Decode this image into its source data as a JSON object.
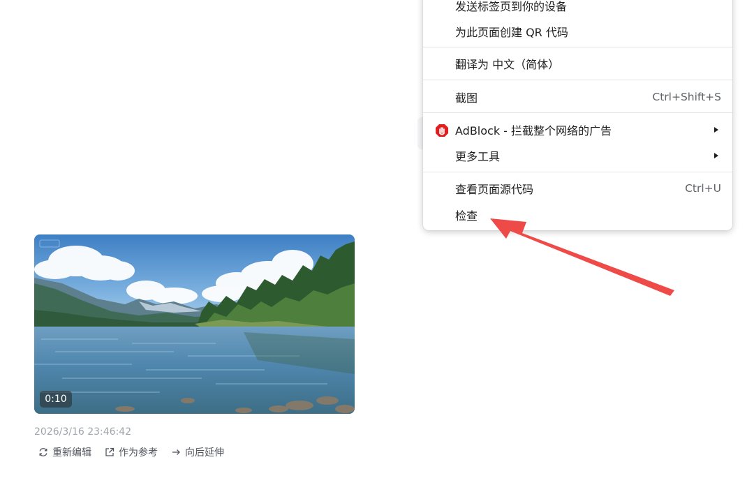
{
  "context_menu": {
    "items": [
      {
        "label": "发送标签页到你的设备",
        "shortcut": ""
      },
      {
        "label": "为此页面创建 QR 代码",
        "shortcut": ""
      },
      {
        "label": "翻译为 中文（简体）",
        "shortcut": ""
      },
      {
        "label": "截图",
        "shortcut": "Ctrl+Shift+S"
      },
      {
        "label": "AdBlock - 拦截整个网络的广告",
        "shortcut": ""
      },
      {
        "label": "更多工具",
        "shortcut": ""
      },
      {
        "label": "查看页面源代码",
        "shortcut": "Ctrl+U"
      },
      {
        "label": "检查",
        "shortcut": ""
      }
    ]
  },
  "video": {
    "duration": "0:10",
    "created_at": "2026/3/16 23:46:42"
  },
  "actions": {
    "re_edit": "重新编辑",
    "use_as_reference": "作为参考",
    "extend_backward": "向后延伸"
  },
  "icons": {
    "adblock": "hand-stop-icon",
    "re_edit": "refresh-icon",
    "use_as_reference": "external-link-icon",
    "extend_backward": "arrow-right-icon",
    "submenu": "chevron-right-icon"
  },
  "colors": {
    "adblock_red": "#e02020",
    "annotation_arrow": "#ee4a48",
    "menu_text": "#1f1f1f",
    "shortcut_text": "#5f6368"
  }
}
